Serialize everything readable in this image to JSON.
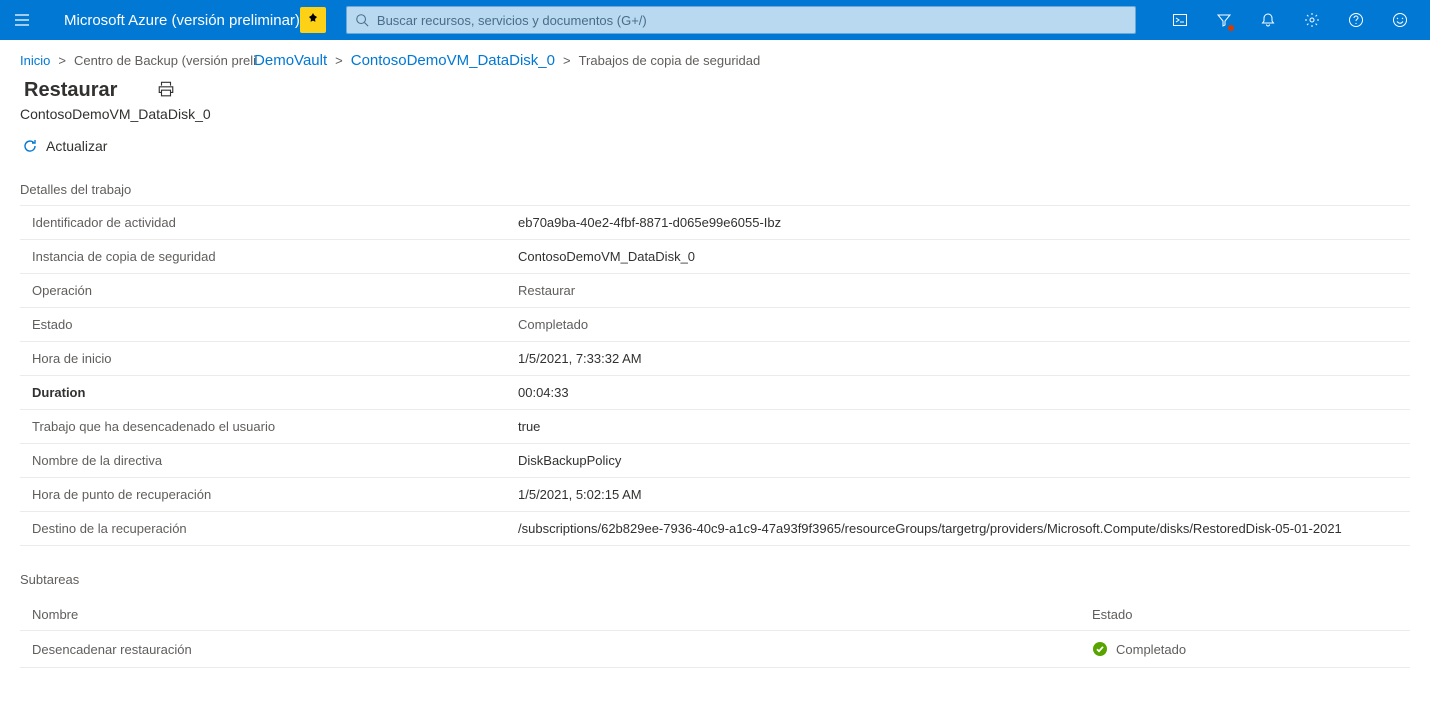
{
  "header": {
    "brand": "Microsoft Azure (versión preliminar)",
    "search_placeholder": "Buscar recursos, servicios y documentos (G+/)"
  },
  "breadcrumb": {
    "home": "Inicio",
    "bc_prefix": "Centro de Backup (versión preli",
    "vault": "DemoVault",
    "item": "ContosoDemoVM_DataDisk_0",
    "current": "Trabajos de copia de seguridad"
  },
  "page": {
    "title": "Restaurar",
    "subtitle": "ContosoDemoVM_DataDisk_0"
  },
  "toolbar": {
    "refresh_label": "Actualizar"
  },
  "details": {
    "section_title": "Detalles del trabajo",
    "rows": [
      {
        "label": "Identificador de actividad",
        "value": "eb70a9ba-40e2-4fbf-8871-d065e99e6055-Ibz",
        "muted": false
      },
      {
        "label": "Instancia de copia de seguridad",
        "value": "ContosoDemoVM_DataDisk_0",
        "muted": false
      },
      {
        "label": "Operación",
        "value": "Restaurar",
        "muted": true
      },
      {
        "label": "Estado",
        "value": "Completado",
        "muted": true
      },
      {
        "label": "Hora de inicio",
        "value": "1/5/2021, 7:33:32 AM",
        "muted": false
      },
      {
        "label": "Duration",
        "value": "00:04:33",
        "strong": true
      },
      {
        "label": "Trabajo que ha desencadenado el usuario",
        "value": "true",
        "muted": false
      },
      {
        "label": "Nombre de la directiva",
        "value": "DiskBackupPolicy",
        "muted": false
      },
      {
        "label": "Hora de punto de recuperación",
        "value": "1/5/2021, 5:02:15 AM",
        "muted": false
      },
      {
        "label": "Destino de la recuperación",
        "value": "/subscriptions/62b829ee-7936-40c9-a1c9-47a93f9f3965/resourceGroups/targetrg/providers/Microsoft.Compute/disks/RestoredDisk-05-01-2021",
        "muted": false
      }
    ]
  },
  "subtasks": {
    "section_title": "Subtareas",
    "col_name": "Nombre",
    "col_status": "Estado",
    "rows": [
      {
        "name": "Desencadenar restauración",
        "status": "Completado"
      }
    ]
  }
}
